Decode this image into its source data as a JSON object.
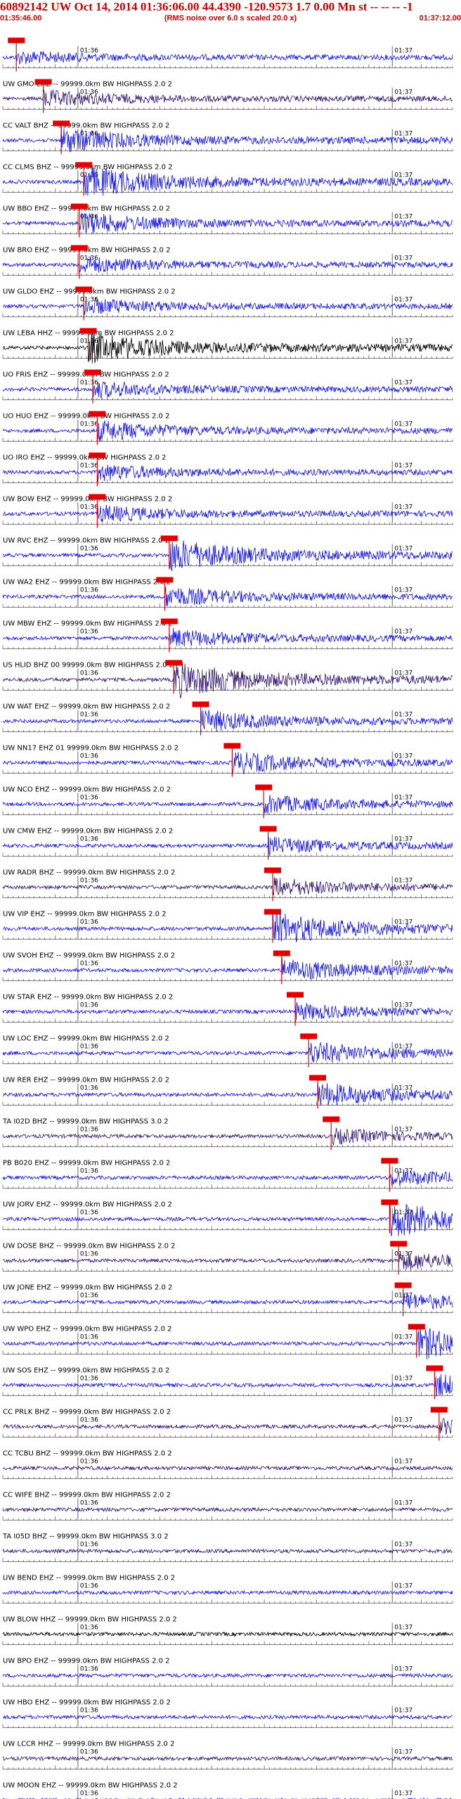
{
  "header": {
    "event_line": "60892142 UW Oct 14, 2014 01:36:06.00   44.4390 -120.9573  1.7 0.00 Mn st -- -- --   -1",
    "start_time": "01:35:46.00",
    "rms_note": "(RMS noise over 6.0 s scaled 20.0 x)",
    "end_time": "01:37:12.00"
  },
  "colors": {
    "red": "#e00000",
    "blue": "#1010ee",
    "navy": "#2a1070",
    "black": "#000000",
    "gray": "#888888"
  },
  "chart_data": {
    "type": "line",
    "title": "60892142 UW Oct 14, 2014 01:36:06.00   44.4390 -120.9573  1.7 0.00 Mn st -- -- --   -1",
    "x_start": "01:35:46.00",
    "x_end": "01:37:12.00",
    "minute_marks": [
      "01:36",
      "01:37"
    ],
    "traces": [
      {
        "label": "",
        "color": "blue",
        "pick": 0.03,
        "amp": 0.35
      },
      {
        "label": "UW GMO EHZ -- 99999.0km BW  HIGHPASS  2.0  2",
        "color": "navy",
        "pick": 0.09,
        "amp": 0.45
      },
      {
        "label": "CC VALT BHZ -- 99999.0km BW  HIGHPASS  2.0  2",
        "color": "blue",
        "pick": 0.13,
        "amp": 0.7
      },
      {
        "label": "CC CLMS BHZ -- 99999.0km BW  HIGHPASS  2.0  2",
        "color": "blue",
        "pick": 0.18,
        "amp": 0.9
      },
      {
        "label": "UW BBO EHZ -- 99999.0km BW  HIGHPASS  2.0  2",
        "color": "blue",
        "pick": 0.17,
        "amp": 0.6
      },
      {
        "label": "UW BRO EHZ -- 99999.0km BW  HIGHPASS  2.0  2",
        "color": "blue",
        "pick": 0.17,
        "amp": 0.45
      },
      {
        "label": "UW GLDO EHZ -- 99999.0km BW  HIGHPASS  2.0  2",
        "color": "blue",
        "pick": 0.18,
        "amp": 0.45
      },
      {
        "label": "UW LEBA HHZ -- 99999.0km BW  HIGHPASS  2.0  2",
        "color": "black",
        "pick": 0.19,
        "amp": 0.85
      },
      {
        "label": "UO FRIS EHZ -- 99999.0km BW  HIGHPASS  2.0  2",
        "color": "blue",
        "pick": 0.2,
        "amp": 0.45
      },
      {
        "label": "UO HUO EHZ -- 99999.0km BW  HIGHPASS  2.0  2",
        "color": "blue",
        "pick": 0.21,
        "amp": 0.55
      },
      {
        "label": "UO IRO EHZ -- 99999.0km BW  HIGHPASS  2.0  2",
        "color": "blue",
        "pick": 0.21,
        "amp": 0.45
      },
      {
        "label": "UW BOW EHZ -- 99999.0km BW  HIGHPASS  2.0  2",
        "color": "blue",
        "pick": 0.21,
        "amp": 0.45
      },
      {
        "label": "UW RVC EHZ -- 99999.0km BW  HIGHPASS  2.0  2",
        "color": "blue",
        "pick": 0.37,
        "amp": 0.9
      },
      {
        "label": "UW WA2 EHZ -- 99999.0km BW  HIGHPASS  2.0  2",
        "color": "blue",
        "pick": 0.36,
        "amp": 0.55
      },
      {
        "label": "UW MBW EHZ -- 99999.0km BW  HIGHPASS  2.0  2",
        "color": "blue",
        "pick": 0.37,
        "amp": 0.5
      },
      {
        "label": "US HLID BHZ 00 99999.0km BW  HIGHPASS  2.0  2",
        "color": "navy",
        "pick": 0.38,
        "amp": 1.0
      },
      {
        "label": "UW WAT EHZ -- 99999.0km BW  HIGHPASS  2.0  2",
        "color": "blue",
        "pick": 0.44,
        "amp": 0.6
      },
      {
        "label": "UW NN17 EHZ 01 99999.0km BW  HIGHPASS  2.0  2",
        "color": "blue",
        "pick": 0.51,
        "amp": 0.6
      },
      {
        "label": "UW NCO EHZ -- 99999.0km BW  HIGHPASS  2.0  2",
        "color": "blue",
        "pick": 0.58,
        "amp": 0.5
      },
      {
        "label": "UW CMW EHZ -- 99999.0km BW  HIGHPASS  2.0  2",
        "color": "blue",
        "pick": 0.59,
        "amp": 0.45
      },
      {
        "label": "UW RADR BHZ -- 99999.0km BW  HIGHPASS  2.0  2",
        "color": "navy",
        "pick": 0.6,
        "amp": 0.5
      },
      {
        "label": "UW VIP EHZ -- 99999.0km BW  HIGHPASS  2.0  2",
        "color": "blue",
        "pick": 0.6,
        "amp": 0.9
      },
      {
        "label": "UW SVOH EHZ -- 99999.0km BW  HIGHPASS  2.0  2",
        "color": "blue",
        "pick": 0.62,
        "amp": 0.6
      },
      {
        "label": "UW STAR EHZ -- 99999.0km BW  HIGHPASS  2.0  2",
        "color": "blue",
        "pick": 0.65,
        "amp": 0.45
      },
      {
        "label": "UW LOC EHZ -- 99999.0km BW  HIGHPASS  2.0  2",
        "color": "blue",
        "pick": 0.68,
        "amp": 0.6
      },
      {
        "label": "UW RER EHZ -- 99999.0km BW  HIGHPASS  2.0  2",
        "color": "blue",
        "pick": 0.7,
        "amp": 0.65
      },
      {
        "label": "TA I02D BHZ -- 99999.0km BW  HIGHPASS  3.0  2",
        "color": "navy",
        "pick": 0.73,
        "amp": 0.4
      },
      {
        "label": "PB B020 EHZ -- 99999.0km BW  HIGHPASS  2.0  2",
        "color": "blue",
        "pick": 0.86,
        "amp": 0.45
      },
      {
        "label": "UW JORV EHZ -- 99999.0km BW  HIGHPASS  2.0  2",
        "color": "blue",
        "pick": 0.86,
        "amp": 1.0
      },
      {
        "label": "UW DOSE BHZ -- 99999.0km BW  HIGHPASS  2.0  2",
        "color": "navy",
        "pick": 0.88,
        "amp": 0.5
      },
      {
        "label": "UW JONE EHZ -- 99999.0km BW  HIGHPASS  2.0  2",
        "color": "blue",
        "pick": 0.89,
        "amp": 0.45
      },
      {
        "label": "UW WPO EHZ -- 99999.0km BW  HIGHPASS  2.0  2",
        "color": "blue",
        "pick": 0.92,
        "amp": 0.9
      },
      {
        "label": "UW SOS EHZ -- 99999.0km BW  HIGHPASS  2.0  2",
        "color": "blue",
        "pick": 0.96,
        "amp": 0.6
      },
      {
        "label": "CC PRLK BHZ -- 99999.0km BW  HIGHPASS  2.0  2",
        "color": "navy",
        "pick": 0.97,
        "amp": 0.4
      },
      {
        "label": "CC TCBU BHZ -- 99999.0km BW  HIGHPASS  2.0  2",
        "color": "navy",
        "pick": null,
        "amp": 0.4
      },
      {
        "label": "CC WIFE BHZ -- 99999.0km BW  HIGHPASS  2.0  2",
        "color": "navy",
        "pick": null,
        "amp": 0.4
      },
      {
        "label": "TA I05D BHZ -- 99999.0km BW  HIGHPASS  3.0  2",
        "color": "navy",
        "pick": null,
        "amp": 0.4
      },
      {
        "label": "UW BEND EHZ -- 99999.0km BW  HIGHPASS  2.0  2",
        "color": "blue",
        "pick": null,
        "amp": 0.4
      },
      {
        "label": "UW BLOW HHZ -- 99999.0km BW  HIGHPASS  2.0  2",
        "color": "black",
        "pick": null,
        "amp": 0.5
      },
      {
        "label": "UW BPO EHZ -- 99999.0km BW  HIGHPASS  2.0  2",
        "color": "blue",
        "pick": null,
        "amp": 0.4
      },
      {
        "label": "UW HBO EHZ -- 99999.0km BW  HIGHPASS  2.0  2",
        "color": "blue",
        "pick": null,
        "amp": 0.4
      },
      {
        "label": "UW LCCR HHZ -- 99999.0km BW  HIGHPASS  2.0  2",
        "color": "navy",
        "pick": null,
        "amp": 0.45
      },
      {
        "label": "UW MOON EHZ -- 99999.0km BW  HIGHPASS  2.0  2",
        "color": "blue",
        "pick": null,
        "amp": 0.4
      }
    ]
  }
}
